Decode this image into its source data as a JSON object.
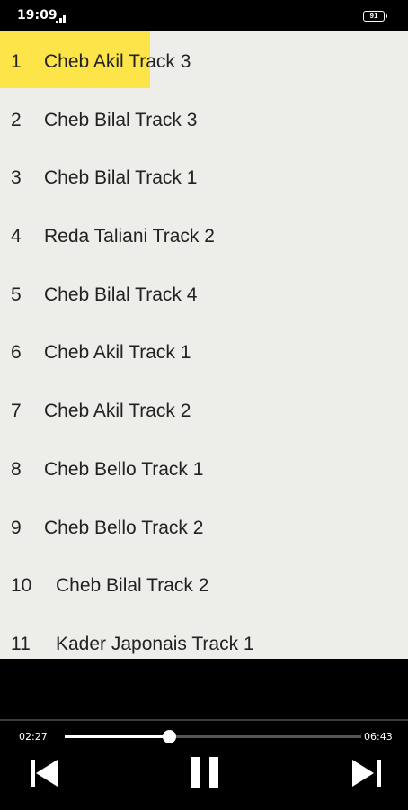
{
  "status_bar": {
    "time": "19:09",
    "battery": "91"
  },
  "tracks": [
    {
      "number": "1",
      "title": "Cheb Akil Track 3",
      "selected": true
    },
    {
      "number": "2",
      "title": "Cheb Bilal Track 3",
      "selected": false
    },
    {
      "number": "3",
      "title": "Cheb Bilal Track 1",
      "selected": false
    },
    {
      "number": "4",
      "title": "Reda Taliani Track 2",
      "selected": false
    },
    {
      "number": "5",
      "title": "Cheb Bilal Track 4",
      "selected": false
    },
    {
      "number": "6",
      "title": "Cheb Akil Track 1",
      "selected": false
    },
    {
      "number": "7",
      "title": "Cheb Akil Track 2",
      "selected": false
    },
    {
      "number": "8",
      "title": "Cheb Bello Track 1",
      "selected": false
    },
    {
      "number": "9",
      "title": "Cheb Bello Track 2",
      "selected": false
    },
    {
      "number": "10",
      "title": "Cheb Bilal Track 2",
      "selected": false
    },
    {
      "number": "11",
      "title": "Kader Japonais Track 1",
      "selected": false
    }
  ],
  "player": {
    "current_time": "02:27",
    "total_time": "06:43",
    "progress": 0.35
  },
  "colors": {
    "highlight": "#fce449",
    "list_background": "#ededea",
    "player_background": "#000000"
  },
  "icons": {
    "previous": "skip-previous-icon",
    "pause": "pause-icon",
    "next": "skip-next-icon"
  }
}
